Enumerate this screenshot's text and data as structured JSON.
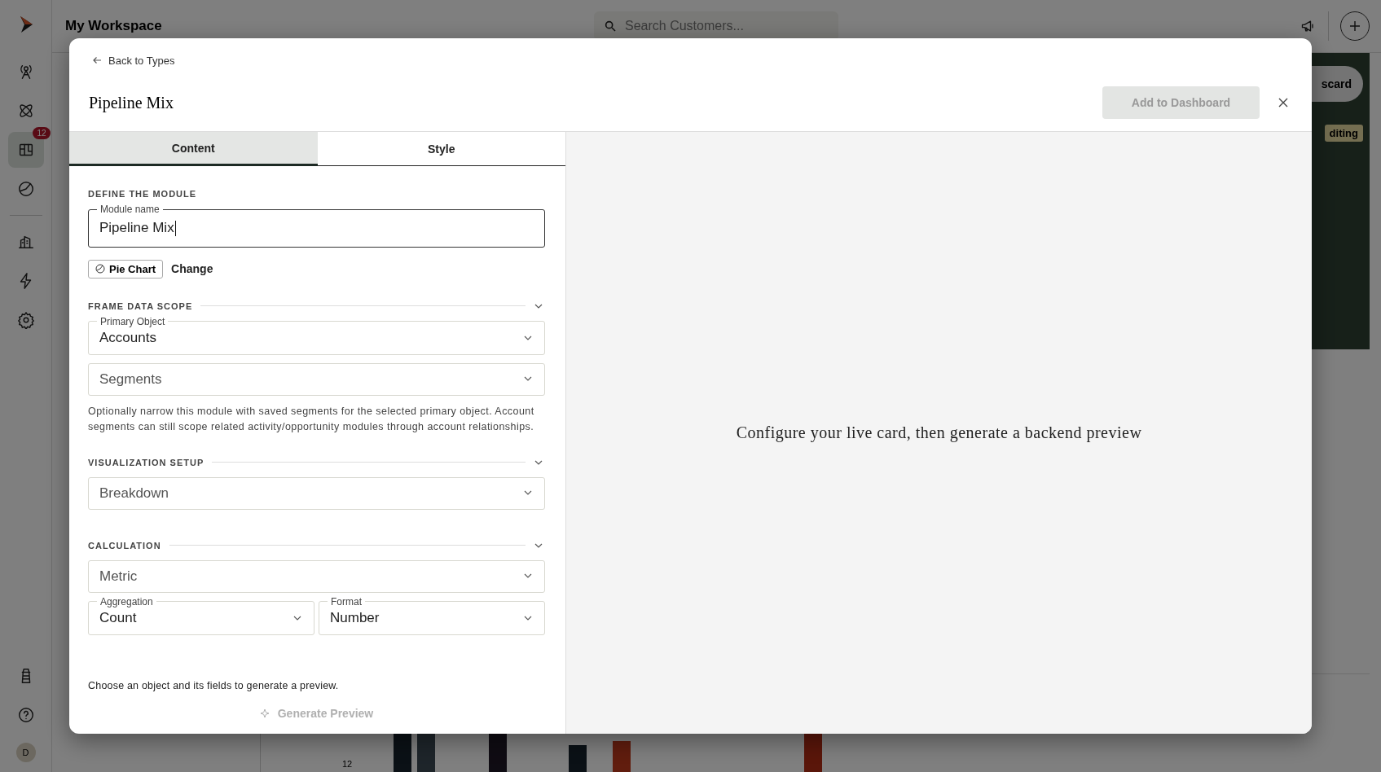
{
  "app": {
    "title": "My Workspace",
    "search": {
      "placeholder": "Search Customers..."
    },
    "sidebar": {
      "items": [
        {
          "selected": false
        },
        {
          "selected": false
        },
        {
          "selected": true,
          "badge": "12"
        },
        {
          "selected": false
        },
        {
          "selected": false
        },
        {
          "selected": false
        },
        {
          "selected": false
        }
      ],
      "footer_items": [
        {
          "selected": false
        },
        {
          "selected": false
        }
      ],
      "avatar": "D"
    },
    "discard_button": "scard",
    "editing_tag": "diting",
    "chart_axis_label": "12"
  },
  "modal": {
    "back_link": "Back to Types",
    "title": "Pipeline Mix",
    "add_button": {
      "label": "Add to Dashboard",
      "disabled": true
    },
    "tabs": [
      {
        "label": "Content",
        "selected": true
      },
      {
        "label": "Style",
        "selected": false
      }
    ],
    "define": {
      "heading": "DEFINE THE MODULE",
      "module_name": {
        "label": "Module name",
        "value": "Pipeline Mix"
      },
      "chart_type": "Pie Chart",
      "change_link": "Change"
    },
    "sections": [
      {
        "heading": "FRAME DATA SCOPE",
        "expanded": true,
        "rows": [
          [
            {
              "label": "Primary Object",
              "value": "Accounts"
            }
          ],
          [
            {
              "placeholder": "Segments"
            }
          ]
        ],
        "help": "Optionally narrow this module with saved segments for the selected primary object. Account segments can still scope related activity/opportunity modules through account relationships."
      },
      {
        "heading": "VISUALIZATION SETUP",
        "expanded": true,
        "rows": [
          [
            {
              "placeholder": "Breakdown"
            }
          ]
        ]
      },
      {
        "heading": "CALCULATION",
        "expanded": true,
        "rows": [
          [
            {
              "placeholder": "Metric"
            }
          ],
          [
            {
              "label": "Aggregation",
              "value": "Count"
            },
            {
              "label": "Format",
              "value": "Number"
            }
          ]
        ]
      }
    ],
    "footer_hint": "Choose an object and its fields to generate a preview.",
    "generate_button": {
      "label": "Generate Preview",
      "disabled": true
    },
    "preview_message": "Configure your live card, then generate a backend preview"
  }
}
